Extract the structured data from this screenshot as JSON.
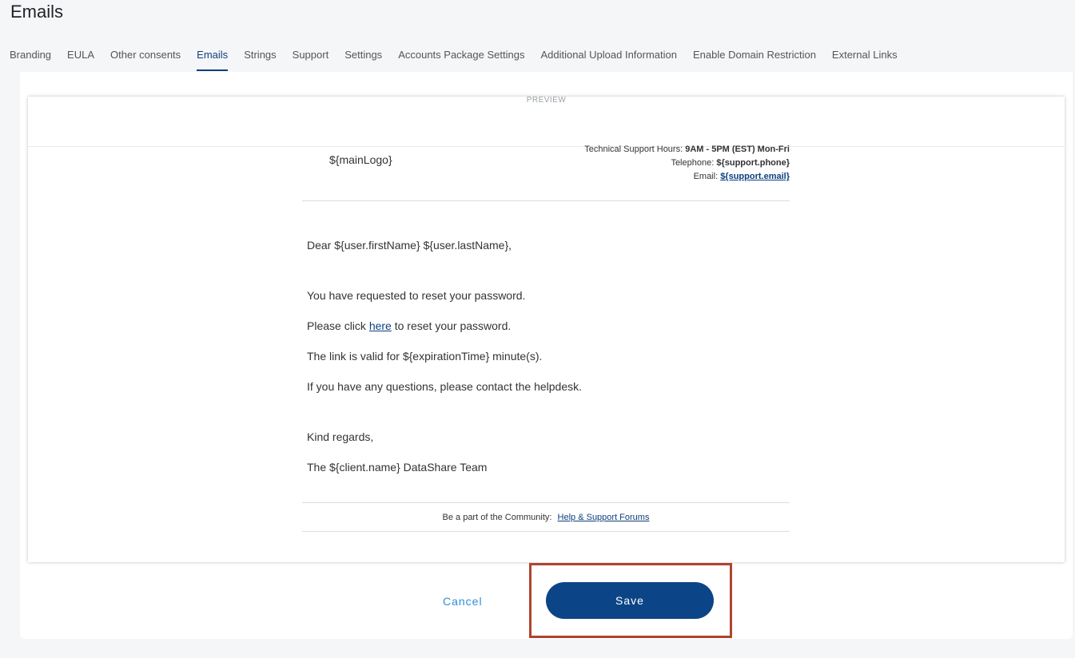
{
  "page": {
    "title": "Emails"
  },
  "tabs": [
    {
      "label": "Branding"
    },
    {
      "label": "EULA"
    },
    {
      "label": "Other consents"
    },
    {
      "label": "Emails",
      "active": true
    },
    {
      "label": "Strings"
    },
    {
      "label": "Support"
    },
    {
      "label": "Settings"
    },
    {
      "label": "Accounts Package Settings"
    },
    {
      "label": "Additional Upload Information"
    },
    {
      "label": "Enable Domain Restriction"
    },
    {
      "label": "External Links"
    }
  ],
  "preview": {
    "label": "PREVIEW",
    "header": {
      "logo": "${mainLogo}",
      "hours_label": "Technical Support Hours:",
      "hours_value": "9AM - 5PM (EST) Mon-Fri",
      "telephone_label": "Telephone:",
      "telephone_value": "${support.phone}",
      "email_label": "Email:",
      "email_value": "${support.email}"
    },
    "body": {
      "greeting": "Dear ${user.firstName} ${user.lastName},",
      "line1": "You have requested to reset your password.",
      "line2_before": "Please click",
      "line2_link": "here",
      "line2_after": "to reset your password.",
      "line3": "The link is valid for ${expirationTime} minute(s).",
      "line4": "If you have any questions, please contact the helpdesk.",
      "closing": "Kind regards,",
      "signature": "The ${client.name} DataShare Team"
    },
    "footer": {
      "text": "Be a part of the Community:",
      "link": "Help & Support Forums"
    }
  },
  "actions": {
    "cancel_label": "Cancel",
    "save_label": "Save"
  },
  "colors": {
    "accent": "#0c4587",
    "link": "#2e8ed6",
    "highlight": "#b0442d"
  }
}
